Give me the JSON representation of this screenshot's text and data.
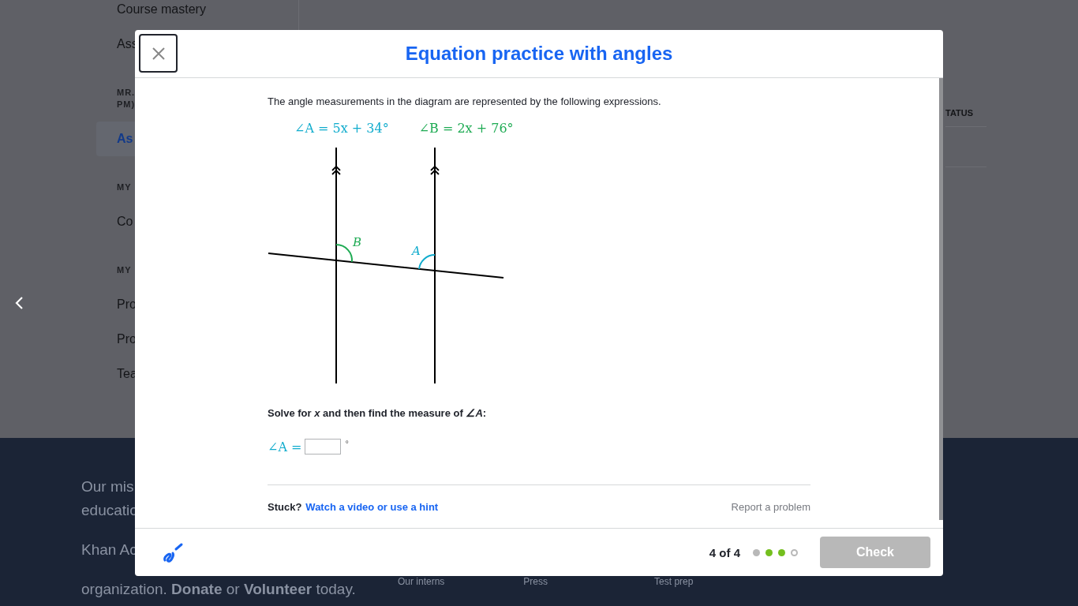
{
  "sidebar": {
    "items": [
      {
        "kind": "item",
        "text": "Course mastery",
        "selected": false
      },
      {
        "kind": "item",
        "text": "Ass",
        "selected": false
      },
      {
        "kind": "heading",
        "lines": [
          "MR.",
          "PM)"
        ]
      },
      {
        "kind": "item",
        "text": "As",
        "selected": true
      },
      {
        "kind": "heading",
        "lines": [
          "MY"
        ]
      },
      {
        "kind": "item",
        "text": "Co",
        "selected": false
      },
      {
        "kind": "heading",
        "lines": [
          "MY"
        ]
      },
      {
        "kind": "item",
        "text": "Pro",
        "selected": false
      },
      {
        "kind": "item",
        "text": "Pro",
        "selected": false
      },
      {
        "kind": "item",
        "text": "Tea",
        "selected": false
      }
    ]
  },
  "table": {
    "columns": [
      "TATUS"
    ]
  },
  "footer": {
    "mission": [
      "Our mis",
      "educatio"
    ],
    "about": [
      "Khan Ac",
      "organization. **Donate** or **Volunteer** today."
    ],
    "links": [
      "Our interns",
      "Press",
      "Test prep"
    ]
  },
  "modal": {
    "title": "Equation practice with angles",
    "intro": "The angle measurements in the diagram are represented by the following expressions.",
    "expressions": [
      {
        "text": "∠A = 5x + 34°",
        "color": "#11accd"
      },
      {
        "text": "∠B = 2x + 76°",
        "color": "#1fab54"
      }
    ],
    "diagram": {
      "angle_labels": [
        {
          "text": "B",
          "color": "#1fab54"
        },
        {
          "text": "A",
          "color": "#11accd"
        }
      ]
    },
    "prompt": "Solve for *x* and then find the measure of *∠A*:",
    "answer": {
      "label": "∠A =",
      "unit": "°"
    },
    "help": {
      "stuck": "Stuck?",
      "hint_link": "Watch a video or use a hint",
      "report": "Report a problem"
    },
    "progress": {
      "text": "4 of 4",
      "dots": [
        {
          "color": "#b8b8b8",
          "selected": false
        },
        {
          "color": "#74bf1e",
          "selected": false
        },
        {
          "color": "#74bf1e",
          "selected": false
        },
        {
          "color": "#b8b8b8",
          "selected": true
        }
      ]
    },
    "check_button": {
      "label": "Check",
      "disabled": true
    }
  }
}
